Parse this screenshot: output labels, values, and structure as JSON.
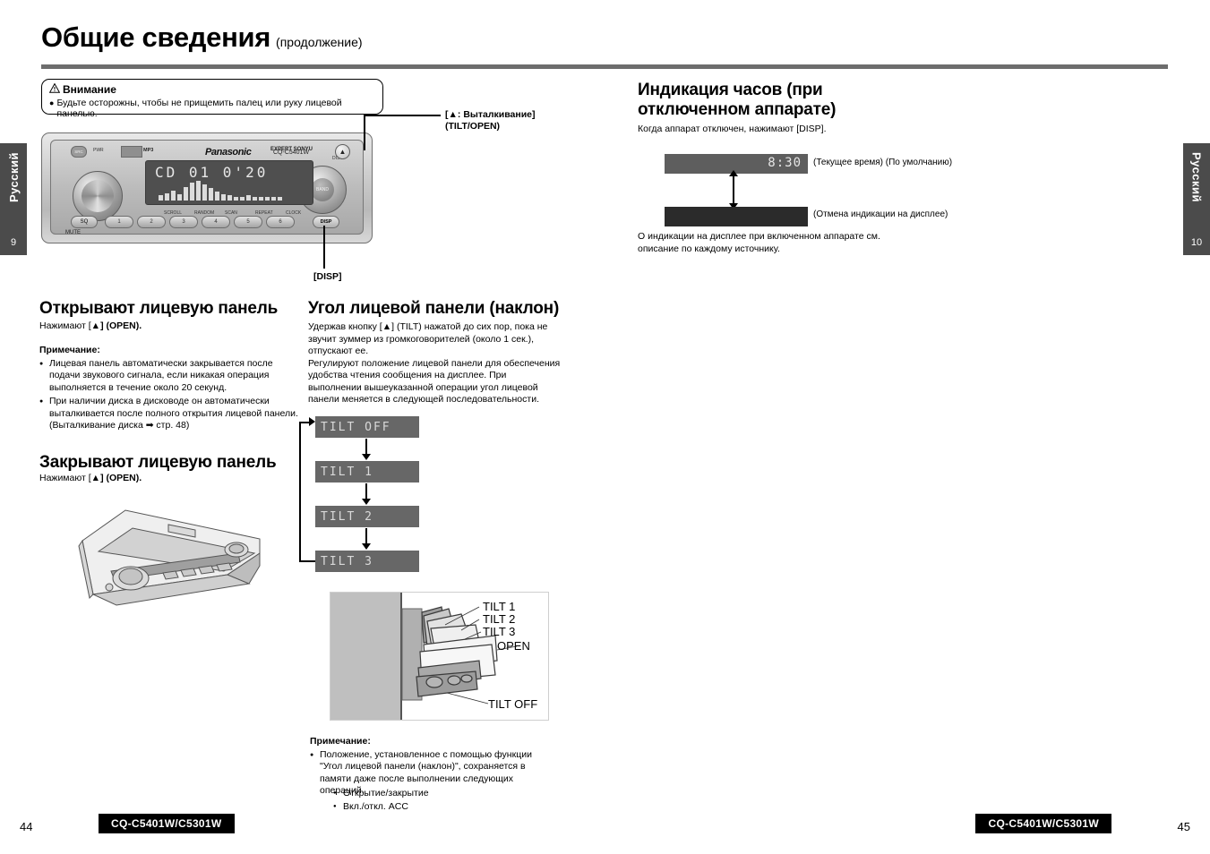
{
  "document": {
    "title_main": "Общие сведения",
    "title_sub": "(продолжение)"
  },
  "side_tabs": {
    "left": {
      "label": "Русский",
      "page": "9"
    },
    "right": {
      "label": "Русский",
      "page": "10"
    }
  },
  "caution": {
    "heading": "Внимание",
    "warning_icon": "warning-triangle-icon",
    "text": "Будьте осторожны, чтобы не прищемить палец или руку лицевой панелью."
  },
  "stereo_unit": {
    "brand": "Panasonic",
    "model": "CQ-C5401W",
    "src_button": "SRC",
    "pwr_label": "PWR",
    "cd_logo": "compact-disc-logo",
    "mp3_label": "MP3",
    "sonyu_label": "EXPERT SONYU",
    "disc_label": "DISC",
    "eject_icon": "eject-icon",
    "mute_label": "MUTE",
    "sq_button": "SQ",
    "disp_button": "DISP",
    "presets": [
      "1",
      "2",
      "3",
      "4",
      "5",
      "6"
    ],
    "preset_functions": [
      "SCROLL",
      "RANDOM",
      "SCAN",
      "REPEAT",
      "CLOCK"
    ],
    "lcd_text": "CD 01  0'20",
    "volume_knob": "volume-knob",
    "tune_knob_label": "BAND",
    "eq_bars": [
      4,
      6,
      8,
      5,
      11,
      14,
      16,
      13,
      10,
      7,
      5,
      4,
      3,
      3,
      4,
      3,
      3,
      3,
      3,
      3
    ]
  },
  "callouts": {
    "eject": {
      "line1_prefix": "[",
      "line1_icon": "eject-icon",
      "line1": ": Выталкивание]",
      "line2": "(TILT/OPEN)"
    },
    "disp": "[DISP]"
  },
  "left_column": {
    "open_panel": {
      "heading": "Открывают лицевую панель",
      "instruction_prefix": "Нажимают [",
      "instruction_icon": "eject-icon",
      "instruction_suffix": "] (OPEN)."
    },
    "note": {
      "heading": "Примечание:",
      "items": [
        "Лицевая панель автоматически закрывается после подачи звукового сигнала, если никакая операция выполняется в течение около 20 секунд.",
        "При наличии диска в дисководе он автоматически выталкивается после полного открытия лицевой панели. (Выталкивание диска ➡ стр. 48)"
      ]
    },
    "close_panel": {
      "heading": "Закрывают лицевую панель",
      "instruction_prefix": "Нажимают [",
      "instruction_icon": "eject-icon",
      "instruction_suffix": "] (OPEN)."
    },
    "faceplate_illustration": "open-faceplate-illustration"
  },
  "middle_column": {
    "tilt": {
      "heading": "Угол лицевой панели (наклон)",
      "paragraph1_a": "Удержав кнопку [",
      "paragraph1_icon": "eject-icon",
      "paragraph1_b": "] (TILT) нажатой до сих пор, пока не звучит зуммер из громкоговорителей (около 1 сек.), отпускают ее.",
      "paragraph2": "Регулируют положение лицевой панели для обеспечения удобства чтения сообщения на дисплее. При выполнении вышеуказанной операции угол лицевой панели меняется в следующей последовательности."
    },
    "tilt_sequence": [
      "TILT OFF",
      "TILT  1",
      "TILT  2",
      "TILT  3"
    ],
    "tilt_diagram_labels": [
      "TILT 1",
      "TILT 2",
      "TILT 3",
      "OPEN",
      "TILT OFF"
    ],
    "tilt_note": {
      "heading": "Примечание:",
      "items": [
        "Положение, установленное с помощью функции \"Угол лицевой панели (наклон)\", сохраняется в памяти даже после выполнении следующих операций."
      ],
      "subitems": [
        "Открытие/закрытие",
        "Вкл./откл. ACC"
      ]
    }
  },
  "right_column": {
    "clock": {
      "heading_line1": "Индикация часов (при",
      "heading_line2": "отключенном аппарате)",
      "intro": "Когда аппарат отключен, нажимают [DISP].",
      "display_value": "8:30",
      "display_caption": "(Текущее время) (По умолчанию)",
      "blank_caption": "(Отмена индикации на дисплее)",
      "footer_line1": "О индикации на дисплее при включенном аппарате см.",
      "footer_line2": "описание по каждому источнику."
    }
  },
  "footer": {
    "left_page": "44",
    "right_page": "45",
    "left_badge": "CQ-C5401W/C5301W",
    "right_badge": "CQ-C5401W/C5301W"
  },
  "colors": {
    "rule": "#6d6d6d",
    "tab_bg": "#4b4b4b",
    "lcd_bg": "#4f4f4f",
    "seq_lcd_bg": "#676767",
    "blank_strip": "#2b2b2b",
    "footer_badge": "#000000"
  }
}
